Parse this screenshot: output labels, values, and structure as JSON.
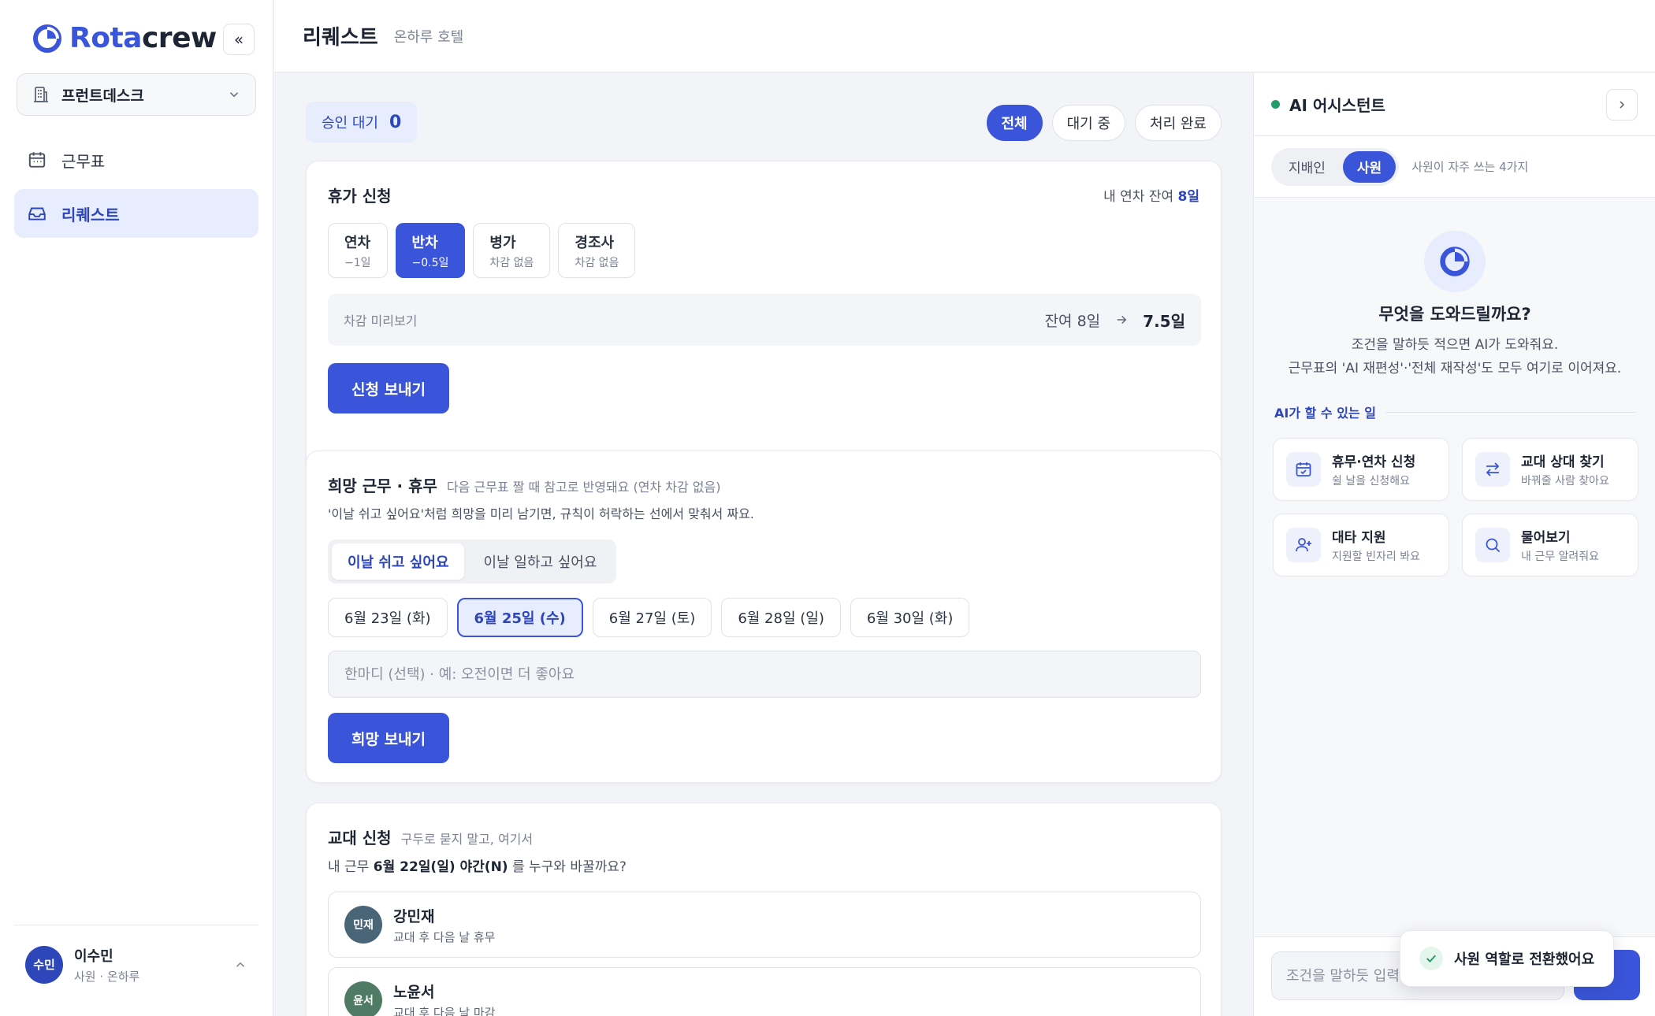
{
  "app": {
    "logo_part1": "Rota",
    "logo_part2": "crew",
    "collapse_label": "«",
    "workspace": "프런트데스크",
    "nav": [
      {
        "label": "근무표"
      },
      {
        "label": "리퀘스트"
      }
    ],
    "user": {
      "initials": "수민",
      "name": "이수민",
      "role": "사원 · 온하루"
    }
  },
  "header": {
    "title": "리퀘스트",
    "subtitle": "온하루 호텔"
  },
  "pending": {
    "label": "승인 대기",
    "count": "0"
  },
  "filters": [
    "전체",
    "대기 중",
    "처리 완료"
  ],
  "leave": {
    "title": "휴가 신청",
    "balance_label": "내 연차 잔여",
    "balance_value": "8일",
    "types": [
      {
        "name": "연차",
        "sub": "−1일"
      },
      {
        "name": "반차",
        "sub": "−0.5일"
      },
      {
        "name": "병가",
        "sub": "차감 없음"
      },
      {
        "name": "경조사",
        "sub": "차감 없음"
      }
    ],
    "preview_label": "차감 미리보기",
    "preview_from": "잔여 8일",
    "preview_to": "7.5일",
    "submit": "신청 보내기"
  },
  "preference": {
    "title": "희망 근무 · 휴무",
    "subtitle": "다음 근무표 짤 때 참고로 반영돼요 (연차 차감 없음)",
    "desc": "'이날 쉬고 싶어요'처럼 희망을 미리 남기면, 규칙이 허락하는 선에서 맞춰서 짜요.",
    "modes": [
      "이날 쉬고 싶어요",
      "이날 일하고 싶어요"
    ],
    "dates": [
      "6월 23일 (화)",
      "6월 25일 (수)",
      "6월 27일 (토)",
      "6월 28일 (일)",
      "6월 30일 (화)"
    ],
    "comment_placeholder": "한마디 (선택) · 예: 오전이면 더 좋아요",
    "submit": "희망 보내기"
  },
  "swap": {
    "title": "교대 신청",
    "subtitle": "구두로 묻지 말고, 여기서",
    "q_prefix": "내 근무",
    "q_shift": "6월 22일(일) 야간(N)",
    "q_suffix": "를 누구와 바꿀까요?",
    "people": [
      {
        "initials": "민재",
        "name": "강민재",
        "desc": "교대 후 다음 날 휴무"
      },
      {
        "initials": "윤서",
        "name": "노윤서",
        "desc": "교대 후 다음 날 마감"
      }
    ]
  },
  "ai": {
    "title": "AI 어시스턴트",
    "roles": [
      "지배인",
      "사원"
    ],
    "role_hint": "사원이 자주 쓰는 4가지",
    "heading": "무엇을 도와드릴까요?",
    "desc1": "조건을 말하듯 적으면 AI가 도와줘요.",
    "desc2": "근무표의 'AI 재편성'·'전체 재작성'도 모두 여기로 이어져요.",
    "can_label": "AI가 할 수 있는 일",
    "tiles": [
      {
        "name": "휴무·연차 신청",
        "desc": "쉴 날을 신청해요",
        "icon": "calendar-check-icon"
      },
      {
        "name": "교대 상대 찾기",
        "desc": "바꿔줄 사람 찾아요",
        "icon": "swap-arrows-icon"
      },
      {
        "name": "대타 지원",
        "desc": "지원할 빈자리 봐요",
        "icon": "user-plus-icon"
      },
      {
        "name": "물어보기",
        "desc": "내 근무 알려줘요",
        "icon": "search-icon"
      }
    ],
    "input_placeholder": "조건을 말하듯 입력",
    "toast": "사원 역할로 전환했어요"
  },
  "colors": {
    "accent": "#3a55d9",
    "success": "#1f9d6b",
    "avatar1": "#4a6478",
    "avatar2": "#4f7a63"
  }
}
